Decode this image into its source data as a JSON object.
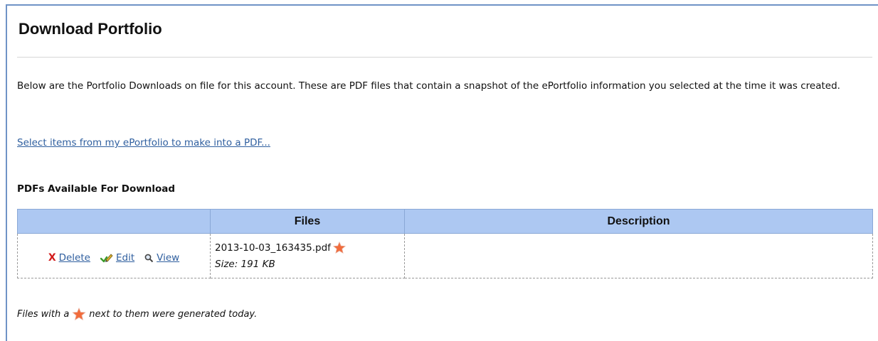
{
  "page": {
    "title": "Download Portfolio",
    "intro": "Below are the Portfolio Downloads on file for this account. These are PDF files that contain a snapshot of the ePortfolio information you selected at the time it was created.",
    "select_link": "Select items from my ePortfolio to make into a PDF..."
  },
  "section": {
    "heading": "PDFs Available For Download"
  },
  "table": {
    "columns": [
      "",
      "Files",
      "Description"
    ],
    "rows": [
      {
        "actions": {
          "delete": "Delete",
          "edit": "Edit",
          "view": "View"
        },
        "file_name": "2013-10-03_163435.pdf",
        "size_label": "Size: 191 KB",
        "description": "",
        "generated_today": true
      }
    ]
  },
  "footnote": {
    "before": "Files with a",
    "after": "next to them were generated today."
  },
  "icons": {
    "star": "star-icon",
    "delete": "x-icon",
    "edit": "pencil-check-icon",
    "view": "magnifier-icon"
  },
  "colors": {
    "header_bg": "#adc8f2",
    "link": "#2f5f9f",
    "star": "#f26b3a",
    "delete": "#d21b1b"
  }
}
